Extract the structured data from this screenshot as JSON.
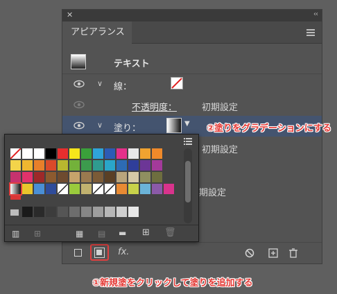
{
  "panel": {
    "tab_label": "アピアランス",
    "close_glyph": "✕",
    "collapse_glyph": "‹‹",
    "object_label": "テキスト",
    "stroke": {
      "label": "線："
    },
    "opacity": {
      "label": "不透明度：",
      "value": "初期設定"
    },
    "fill": {
      "label": "塗り："
    },
    "row_values": [
      "初期設定",
      "期設定"
    ],
    "fx_label": "fx."
  },
  "annotations": {
    "step2": "②塗りをグラデーションにする",
    "step1": "①新規塗をクリックして塗りを追加する"
  },
  "colors": {
    "accent_annotation": "#e53935",
    "panel_bg": "#535353",
    "selected_row": "#44546f"
  },
  "swatches": {
    "row1": [
      "#ffffff",
      "#ffffff",
      "#ffffff",
      "#000000",
      "#e62e2e",
      "#f5e51b",
      "#3aa13a",
      "#2fa4d9",
      "#2d5bb5",
      "#e4308a",
      "#e8e8e8",
      "#f0a330",
      "#f08a2a"
    ],
    "row2": [
      "#f3d44a",
      "#f0b630",
      "#e87f2a",
      "#d94a2a",
      "#b8b72f",
      "#73b13a",
      "#3c9b4d",
      "#2f9b8f",
      "#2aa6c9",
      "#2d6bb4",
      "#2f3e9a",
      "#6c3696",
      "#a33a9a"
    ],
    "row3": [
      "#c6326e",
      "#e2326b",
      "#9e2929",
      "#8c5a2f",
      "#6e4b2f",
      "#c6a36b",
      "#9a7a4f",
      "#7b5b37",
      "#5a4025",
      "#b9a57c",
      "#d6c9a6",
      "#8f8f60",
      "#6e6e3f"
    ],
    "row4": [
      "#ffffff",
      "#e9c52c",
      "#4a8fd6",
      "#2f4c9a",
      "#ffffff",
      "#9acb3c",
      "#c1b26f",
      "#ffffff",
      "#ffffff",
      "#e88a33",
      "#c8d24a",
      "#6bb3d8",
      "#8b5aa8",
      "#d8338c"
    ],
    "gray_row": [
      "#1a1a1a",
      "#2a2a2a",
      "#3c3c3c",
      "#555555",
      "#6d6d6d",
      "#868686",
      "#9e9e9e",
      "#b7b7b7",
      "#cfcfcf",
      "#e7e7e7"
    ]
  }
}
